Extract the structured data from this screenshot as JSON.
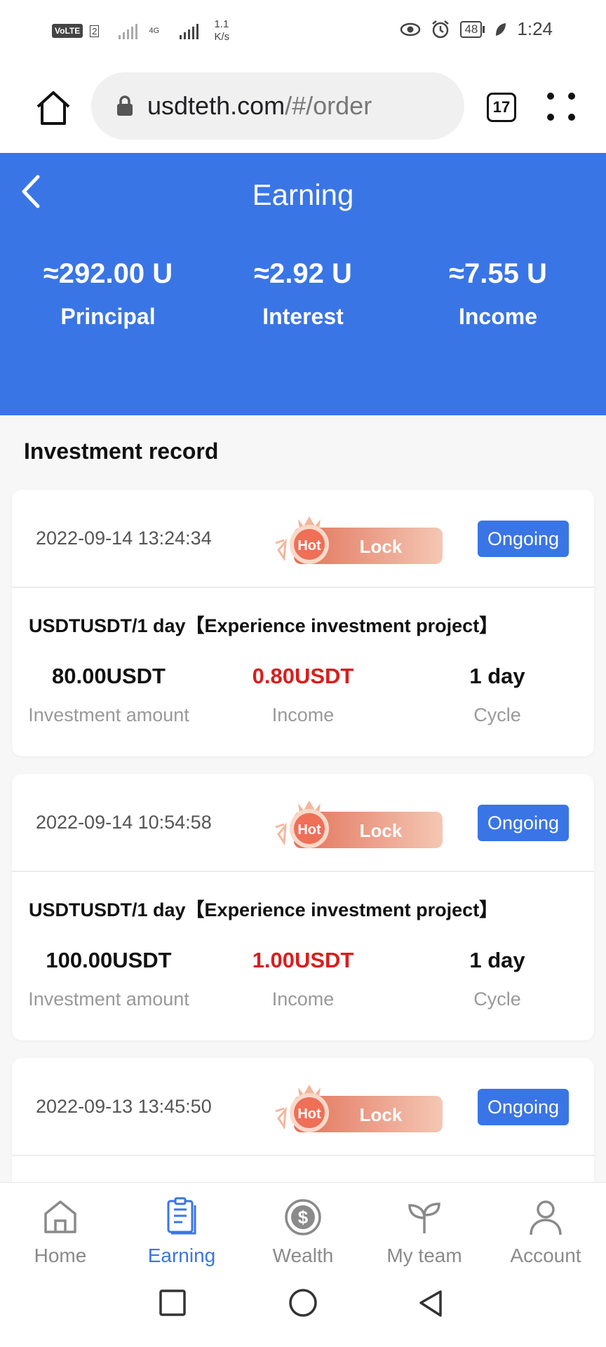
{
  "status_bar": {
    "volte": "VoLTE",
    "sim": "2",
    "network": "4G",
    "speed_value": "1.1",
    "speed_unit": "K/s",
    "battery": "48",
    "time": "1:24"
  },
  "browser": {
    "url_host": "usdteth.com",
    "url_path": "/#/order",
    "tab_count": "17"
  },
  "header": {
    "title": "Earning",
    "stats": [
      {
        "value": "≈292.00 U",
        "label": "Principal"
      },
      {
        "value": "≈2.92 U",
        "label": "Interest"
      },
      {
        "value": "≈7.55 U",
        "label": "Income"
      }
    ]
  },
  "section_title": "Investment record",
  "badge": {
    "hot": "Hot",
    "lock": "Lock"
  },
  "records": [
    {
      "date": "2022-09-14 13:24:34",
      "status": "Ongoing",
      "project": "USDTUSDT/1 day【Experience investment project】",
      "amount": "80.00USDT",
      "amount_label": "Investment amount",
      "income": "0.80USDT",
      "income_label": "Income",
      "cycle": "1 day",
      "cycle_label": "Cycle"
    },
    {
      "date": "2022-09-14 10:54:58",
      "status": "Ongoing",
      "project": "USDTUSDT/1 day【Experience investment project】",
      "amount": "100.00USDT",
      "amount_label": "Investment amount",
      "income": "1.00USDT",
      "income_label": "Income",
      "cycle": "1 day",
      "cycle_label": "Cycle"
    },
    {
      "date": "2022-09-13 13:45:50",
      "status": "Ongoing"
    }
  ],
  "bottom_nav": [
    {
      "label": "Home",
      "icon": "home-icon",
      "active": false
    },
    {
      "label": "Earning",
      "icon": "clipboard-icon",
      "active": true
    },
    {
      "label": "Wealth",
      "icon": "dollar-coin-icon",
      "active": false
    },
    {
      "label": "My team",
      "icon": "sprout-icon",
      "active": false
    },
    {
      "label": "Account",
      "icon": "person-icon",
      "active": false
    }
  ],
  "colors": {
    "primary": "#3a75e6",
    "income_red": "#d81e1e",
    "muted_text": "#999999"
  }
}
